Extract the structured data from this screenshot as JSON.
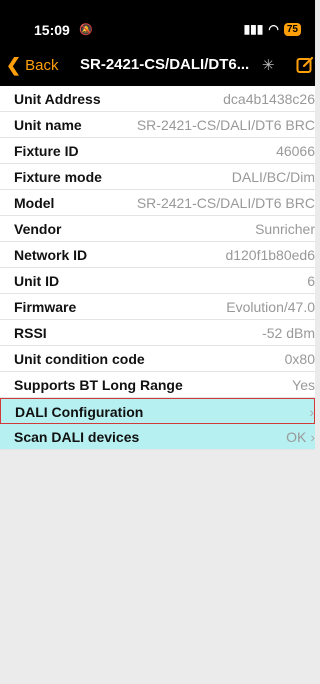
{
  "status_bar": {
    "time": "15:09",
    "battery": "75"
  },
  "nav": {
    "back_label": "Back",
    "title": "SR-2421-CS/DALI/DT6..."
  },
  "rows": [
    {
      "label": "Unit Address",
      "value": "dca4b1438c26"
    },
    {
      "label": "Unit name",
      "value": "SR-2421-CS/DALI/DT6 BRC"
    },
    {
      "label": "Fixture ID",
      "value": "46066"
    },
    {
      "label": "Fixture mode",
      "value": "DALI/BC/Dim"
    },
    {
      "label": "Model",
      "value": "SR-2421-CS/DALI/DT6 BRC"
    },
    {
      "label": "Vendor",
      "value": "Sunricher"
    },
    {
      "label": "Network ID",
      "value": "d120f1b80ed6"
    },
    {
      "label": "Unit ID",
      "value": "6"
    },
    {
      "label": "Firmware",
      "value": "Evolution/47.0"
    },
    {
      "label": "RSSI",
      "value": "-52 dBm"
    },
    {
      "label": "Unit condition code",
      "value": "0x80"
    },
    {
      "label": "Supports BT Long Range",
      "value": "Yes"
    }
  ],
  "actions": [
    {
      "label": "DALI Configuration",
      "value": ""
    },
    {
      "label": "Scan DALI devices",
      "value": "OK"
    }
  ],
  "colors": {
    "accent": "#ff9f0a",
    "action_bg": "#b7f0f0",
    "selected_border": "#d23a3a"
  }
}
